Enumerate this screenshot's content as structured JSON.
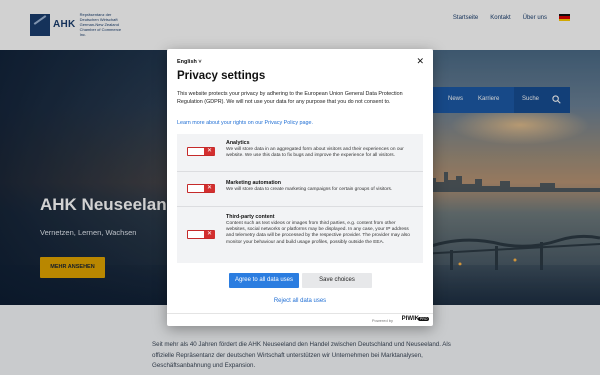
{
  "header": {
    "logo_abbr": "AHK",
    "logo_subtitle": "Repräsentanz der Deutschen Wirtschaft German-New Zealand Chamber of Commerce Inc.",
    "links": [
      "Startseite",
      "Kontakt",
      "Über uns"
    ]
  },
  "nav": {
    "items": [
      "News",
      "Karriere"
    ],
    "search_label": "Suche"
  },
  "hero": {
    "title": "AHK Neuseeland",
    "subtitle": "Vernetzen, Lernen, Wachsen",
    "button": "MEHR ANSEHEN"
  },
  "body_text": "Seit mehr als 40 Jahren fördert die AHK Neuseeland den Handel zwischen Deutschland und Neuseeland. Als offizielle Repräsentanz der deutschen Wirtschaft unterstützen wir Unterneh­men bei Marktanalysen, Geschäftsanbahnung und Expansion.",
  "modal": {
    "language": "English",
    "title": "Privacy settings",
    "intro": "This website protects your privacy by adhering to the European Union General Data Protection Regulation (GDPR). We will not use your data for any purpose that you do not consent to.",
    "policy_link": "Learn more about your rights on our Privacy Policy page.",
    "consents": [
      {
        "title": "Analytics",
        "description": "We will store data in an aggregated form about visitors and their experiences on our website. We use this data to fix bugs and improve the experience for all visitors.",
        "enabled": false
      },
      {
        "title": "Marketing automation",
        "description": "We will store data to create marketing campaigns for certain groups of visitors.",
        "enabled": false
      },
      {
        "title": "Third-party content",
        "description": "Content such as text videos or images from third parties, e.g. content from other websites, social networks or platforms may be displayed. In any case, your IP address and telemetry data will be processed by the respective provider. The provider may also monitor your behaviour and build usage profiles, possibly outside the EEA.",
        "enabled": false
      }
    ],
    "accept_all": "Agree to all data uses",
    "save": "Save choices",
    "reject_all": "Reject all data uses",
    "powered_by": "Powered by",
    "brand": "PIWIK",
    "brand_badge": "PRO"
  },
  "colors": {
    "primary": "#1d5aa6",
    "accent": "#e2a500",
    "toggle_off": "#d32f2f",
    "link": "#1f6ed4"
  }
}
